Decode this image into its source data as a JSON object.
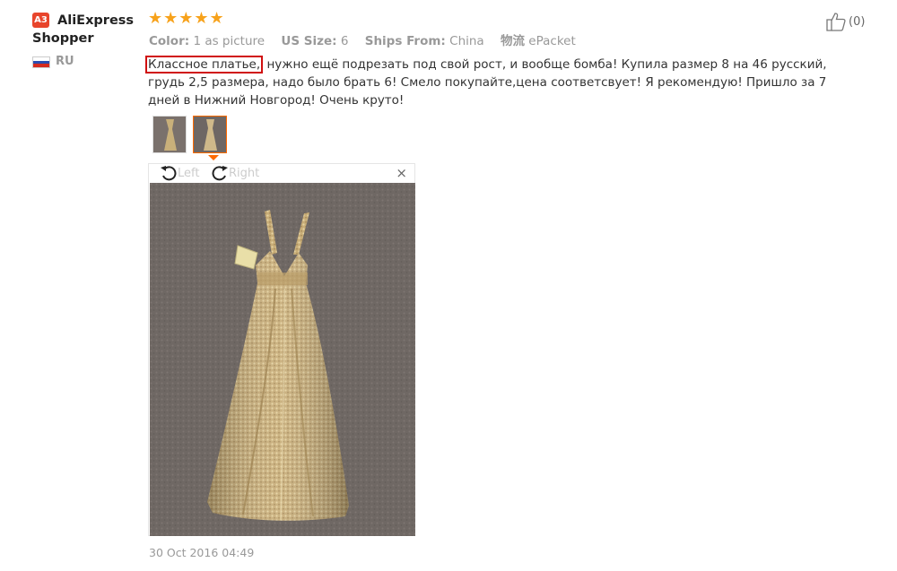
{
  "reviewer": {
    "level_badge": "A3",
    "name": "AliExpress Shopper",
    "country": "RU"
  },
  "rating": {
    "stars": 5,
    "star_glyphs": "★★★★★"
  },
  "attributes": [
    {
      "label": "Color:",
      "value": "1 as picture"
    },
    {
      "label": "US Size:",
      "value": "6"
    },
    {
      "label": "Ships From:",
      "value": "China"
    },
    {
      "label": "物流",
      "value": "ePacket"
    }
  ],
  "like": {
    "count": "(0)"
  },
  "review": {
    "highlighted": "Классное платье,",
    "rest": " нужно ещё подрезать под свой рост, и вообще бомба! Купила размер 8 на 46 русский, грудь 2,5 размера, надо было брать 6! Смело покупайте,цена соответсвует! Я рекомендую! Пришло за 7 дней в Нижний Новгород! Очень круто!"
  },
  "viewer": {
    "rotate_left": "Left",
    "rotate_right": "Right",
    "close": "×"
  },
  "date": "30 Oct 2016 04:49",
  "colors": {
    "accent": "#ff6a00",
    "star": "#f7a21b",
    "badge": "#e8452c",
    "highlight_border": "#d01010"
  }
}
